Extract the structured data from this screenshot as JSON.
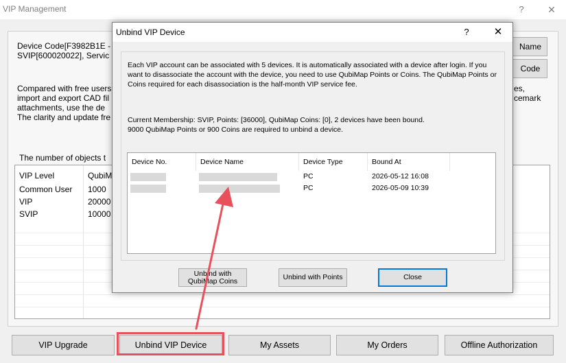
{
  "main": {
    "title": "VIP Management",
    "help_glyph": "?",
    "close_glyph": "✕",
    "device_code_line": "Device Code[F3982B1E -",
    "svip_line": "SVIP[600020022], Servic",
    "desc_lines": [
      "Compared with free users",
      "import and export CAD fil",
      "attachments, use the de",
      "The clarity and update fre"
    ],
    "right_fragments": [
      "es,",
      "cemark"
    ],
    "side_buttons": [
      "Name",
      "Code"
    ],
    "objects_label": "The number of objects t",
    "table": {
      "headers": [
        "VIP Level",
        "QubiMa"
      ],
      "rows": [
        [
          "Common User",
          "1000"
        ],
        [
          "VIP",
          "20000"
        ],
        [
          "SVIP",
          "10000"
        ]
      ]
    },
    "bottom_buttons": [
      "VIP Upgrade",
      "Unbind VIP Device",
      "My Assets",
      "My Orders",
      "Offline Authorization"
    ],
    "highlight_color": "#e8505b"
  },
  "dialog": {
    "title": "Unbind VIP Device",
    "help_glyph": "?",
    "close_glyph": "✕",
    "info": "Each VIP account can be associated with 5 devices. It is automatically associated with a device after login. If you want to disassociate the account with the device, you need to use QubiMap Points or Coins. The QubiMap Points or Coins required for each disassociation is the half-month VIP service fee.",
    "membership": "Current Membership: SVIP, Points: [36000], QubiMap Coins: [0], 2 devices have been bound.",
    "cost": "9000 QubiMap Points or 900 Coins are required to unbind a device.",
    "columns": [
      "Device No.",
      "Device Name",
      "Device Type",
      "Bound At"
    ],
    "devices": [
      {
        "type": "PC",
        "bound_at": "2026-05-12 16:08"
      },
      {
        "type": "PC",
        "bound_at": "2026-05-09 10:39"
      }
    ],
    "buttons": {
      "unbind_coins_line1": "Unbind with",
      "unbind_coins_line2": "QubiMap Coins",
      "unbind_points": "Unbind with Points",
      "close": "Close"
    },
    "accent_color": "#0078d7"
  }
}
